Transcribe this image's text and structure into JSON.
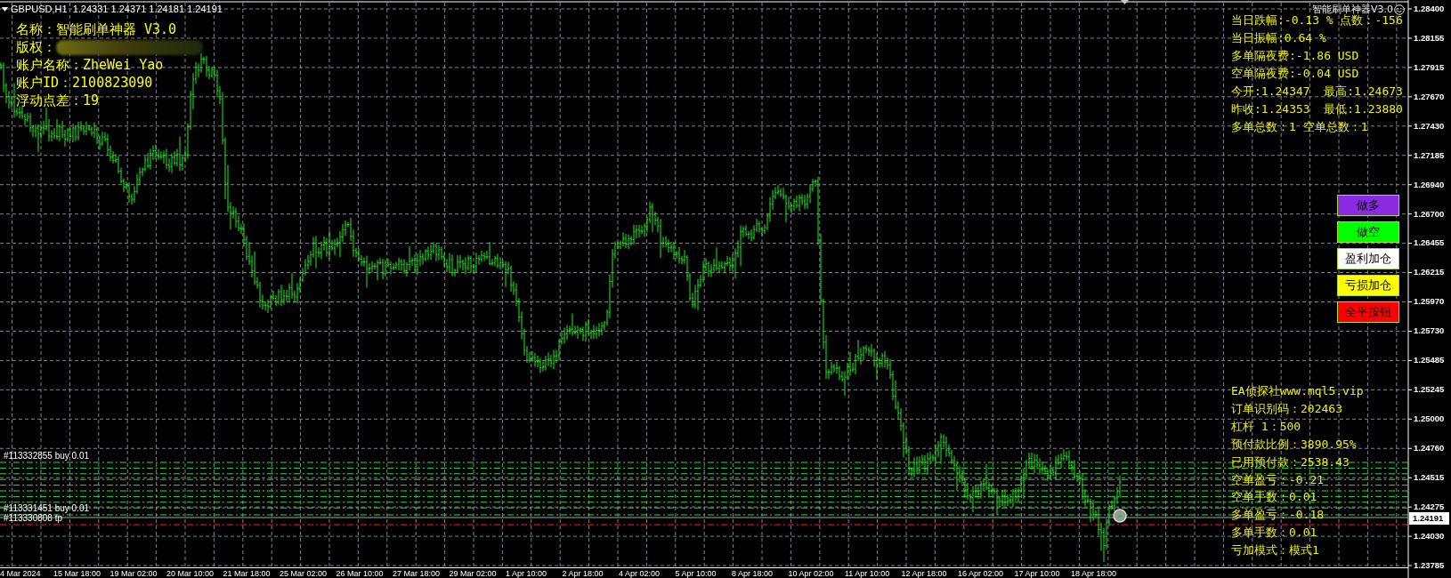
{
  "chart": {
    "symbol_info": "GBPUSD,H1  1.24331 1.24371 1.24181 1.24191",
    "indicator_title": "智能刷单神器V3.0"
  },
  "info_left": [
    {
      "kind": "text",
      "text": "名称：智能刷单神器 V3.0"
    },
    {
      "kind": "redacted",
      "text": "版权："
    },
    {
      "kind": "text",
      "text": "账户名称：ZheWei Yao"
    },
    {
      "kind": "text",
      "text": "账户ID：2100823090"
    },
    {
      "kind": "text",
      "text": "浮动点差：19"
    }
  ],
  "info_right_top": [
    "当日跌幅:-0.13 % 点数：-156",
    "当日振幅:0.64 %",
    "多单隔夜费:-1.86 USD",
    "空单隔夜费:-0.04 USD",
    "今开:1.24347  最高:1.24673",
    "昨收:1.24353  最低:1.23880",
    "多单总数：1 空单总数：1"
  ],
  "buttons": [
    {
      "label": "做多",
      "color": "#8a2be2"
    },
    {
      "label": "做空",
      "color": "#00ff00"
    },
    {
      "label": "盈利加仓",
      "color": "#ffffff"
    },
    {
      "label": "亏损加仓",
      "color": "#ffff00"
    },
    {
      "label": "全平按钮",
      "color": "#ff0000"
    }
  ],
  "info_right_bottom": [
    "EA侦探社www.mql5.vip",
    "订单识别码：202463",
    "杠杆 1：500",
    "预付款比例：3890.95%",
    "已用预付款：2538.43",
    "空单盈亏：-0.21",
    "空单手数：0.01",
    "多单盈亏：-0.18",
    "多单手数：0.01",
    "亏加模式：模式1"
  ],
  "order_lines": [
    {
      "kind": "buy",
      "label": "#113332855 buy 0.01"
    },
    {
      "kind": "buy",
      "label": "#113331451 buy 0.01"
    },
    {
      "kind": "tp",
      "label": "#113330808 tp"
    }
  ],
  "price_axis": {
    "labels": [
      "1.28400",
      "1.28155",
      "1.27915",
      "1.27670",
      "1.27430",
      "1.27185",
      "1.26940",
      "1.26700",
      "1.26455",
      "1.26215",
      "1.25970",
      "1.25730",
      "1.25485",
      "1.25245",
      "1.25000",
      "1.24760",
      "1.24515",
      "1.24275",
      "1.24030",
      "1.23785"
    ],
    "current_price": "1.24191"
  },
  "time_axis": {
    "labels": [
      "4 Mar 2024",
      "15 Mar 18:00",
      "19 Mar 02:00",
      "20 Mar 10:00",
      "21 Mar 18:00",
      "25 Mar 02:00",
      "26 Mar 10:00",
      "27 Mar 18:00",
      "29 Mar 02:00",
      "1 Apr 10:00",
      "2 Apr 18:00",
      "4 Apr 02:00",
      "5 Apr 10:00",
      "8 Apr 18:00",
      "10 Apr 02:00",
      "11 Apr 10:00",
      "12 Apr 18:00",
      "16 Apr 02:00",
      "17 Apr 10:00",
      "18 Apr 18:00"
    ]
  }
}
